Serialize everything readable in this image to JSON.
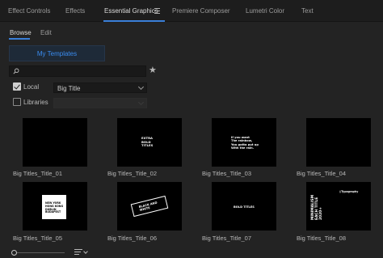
{
  "tabs": [
    {
      "label": "Effect Controls",
      "active": false
    },
    {
      "label": "Effects",
      "active": false
    },
    {
      "label": "Essential Graphics",
      "active": true
    },
    {
      "label": "Premiere Composer",
      "active": false
    },
    {
      "label": "Lumetri Color",
      "active": false
    },
    {
      "label": "Text",
      "active": false
    }
  ],
  "subtabs": {
    "browse": "Browse",
    "edit": "Edit"
  },
  "my_templates_label": "My Templates",
  "search": {
    "value": "",
    "placeholder": ""
  },
  "filters": {
    "local": {
      "label": "Local",
      "checked": true,
      "selected": "Big Title"
    },
    "libraries": {
      "label": "Libraries",
      "checked": false,
      "selected": ""
    }
  },
  "templates": [
    {
      "name": "Big Titles_Title_01",
      "text": ""
    },
    {
      "name": "Big Titles_Title_02",
      "text": "EXTRA\nBOLD\nTITLES"
    },
    {
      "name": "Big Titles_Title_03",
      "text": "If you want\nThe rainbow,\nYou gotta put up\nWith the rain."
    },
    {
      "name": "Big Titles_Title_04",
      "text": ""
    },
    {
      "name": "Big Titles_Title_05",
      "text": "NEW YORK\nHONG KONG\nDUBLIN\nBUDAPEST"
    },
    {
      "name": "Big Titles_Title_06",
      "text": "BLACK AND\nWHITE"
    },
    {
      "name": "Big Titles_Title_07",
      "text": "BOLD TITLES"
    },
    {
      "name": "Big Titles_Title_08",
      "text": "MINIMALISM\nEACH TITLE\n2020+",
      "tag": "//Typography"
    }
  ],
  "colors": {
    "accent": "#3a7fd8",
    "link": "#3a8cf0",
    "panel": "#232323",
    "tabbar": "#1d1d1d"
  }
}
